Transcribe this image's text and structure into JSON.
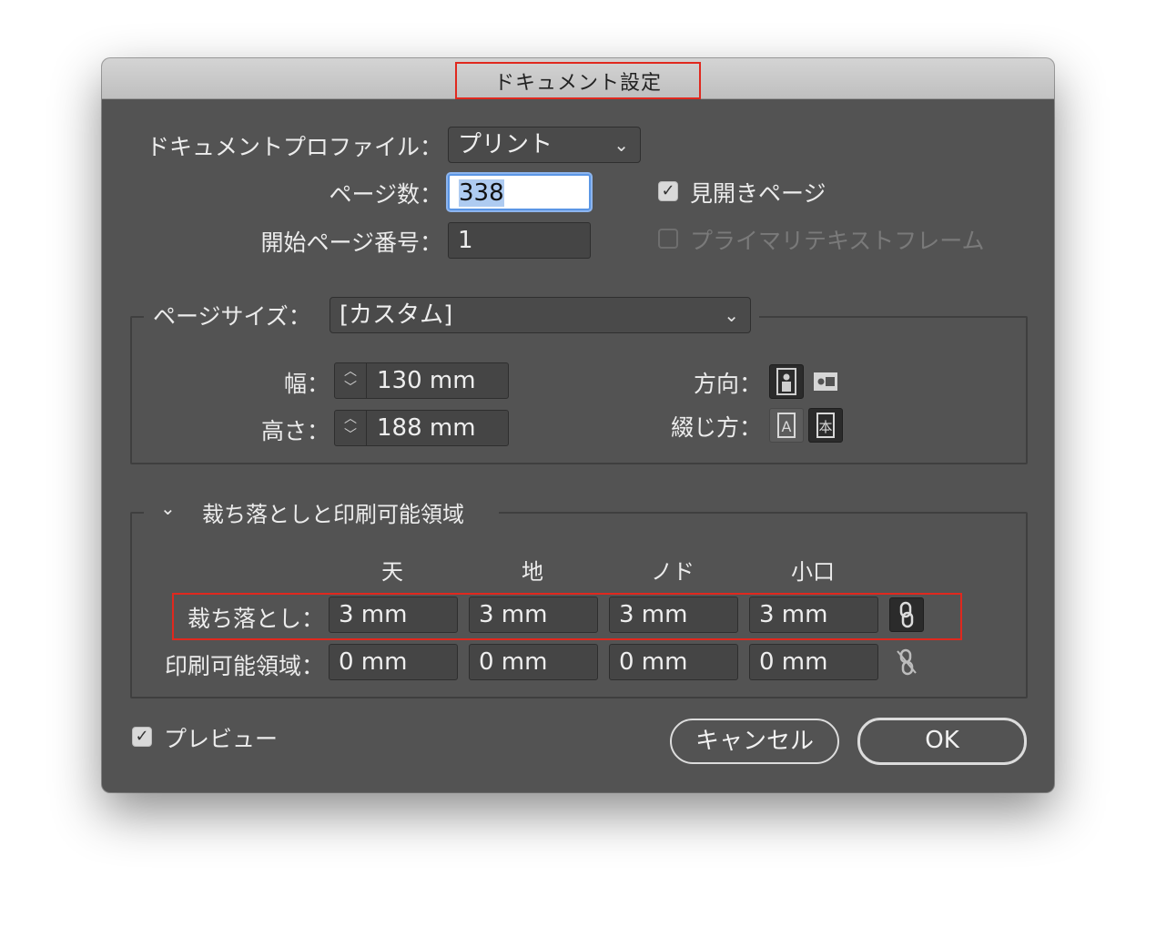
{
  "window": {
    "title": "ドキュメント設定"
  },
  "profile": {
    "label": "ドキュメントプロファイル：",
    "value": "プリント"
  },
  "pages": {
    "label": "ページ数：",
    "value": "338"
  },
  "start_page": {
    "label": "開始ページ番号：",
    "value": "1"
  },
  "facing_pages": {
    "label": "見開きページ",
    "checked": true
  },
  "primary_text_frame": {
    "label": "プライマリテキストフレーム",
    "checked": false,
    "enabled": false
  },
  "page_size": {
    "label": "ページサイズ：",
    "value": "[カスタム]",
    "width_label": "幅：",
    "width_value": "130 mm",
    "height_label": "高さ：",
    "height_value": "188 mm",
    "orientation_label": "方向：",
    "binding_label": "綴じ方：",
    "orientation_selected": "portrait",
    "binding_selected": "right-to-left"
  },
  "bleed_slug": {
    "section_title": "裁ち落としと印刷可能領域",
    "columns": [
      "天",
      "地",
      "ノド",
      "小口"
    ],
    "bleed_label": "裁ち落とし：",
    "bleed_values": [
      "3 mm",
      "3 mm",
      "3 mm",
      "3 mm"
    ],
    "bleed_linked": true,
    "slug_label": "印刷可能領域：",
    "slug_values": [
      "0 mm",
      "0 mm",
      "0 mm",
      "0 mm"
    ],
    "slug_linked": false
  },
  "preview": {
    "label": "プレビュー",
    "checked": true
  },
  "buttons": {
    "cancel": "キャンセル",
    "ok": "OK"
  },
  "highlight_color": "#e0281e"
}
